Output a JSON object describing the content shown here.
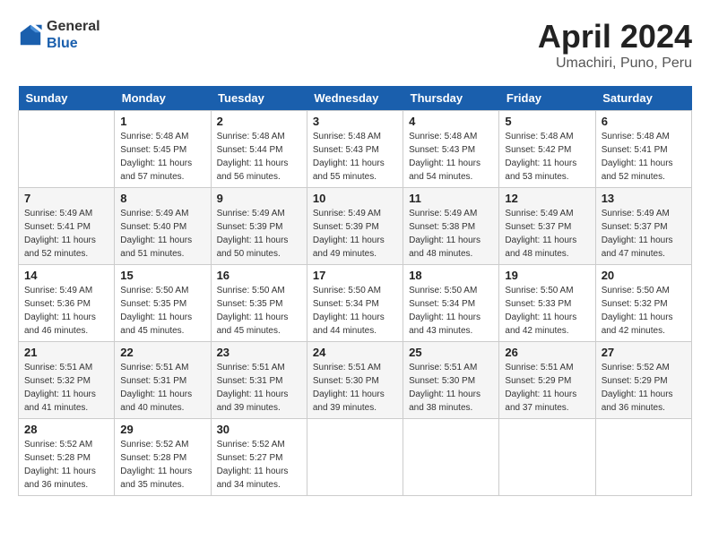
{
  "logo": {
    "general": "General",
    "blue": "Blue"
  },
  "title": "April 2024",
  "subtitle": "Umachiri, Puno, Peru",
  "days_header": [
    "Sunday",
    "Monday",
    "Tuesday",
    "Wednesday",
    "Thursday",
    "Friday",
    "Saturday"
  ],
  "weeks": [
    [
      {
        "day": "",
        "sunrise": "",
        "sunset": "",
        "daylight": ""
      },
      {
        "day": "1",
        "sunrise": "Sunrise: 5:48 AM",
        "sunset": "Sunset: 5:45 PM",
        "daylight": "Daylight: 11 hours and 57 minutes."
      },
      {
        "day": "2",
        "sunrise": "Sunrise: 5:48 AM",
        "sunset": "Sunset: 5:44 PM",
        "daylight": "Daylight: 11 hours and 56 minutes."
      },
      {
        "day": "3",
        "sunrise": "Sunrise: 5:48 AM",
        "sunset": "Sunset: 5:43 PM",
        "daylight": "Daylight: 11 hours and 55 minutes."
      },
      {
        "day": "4",
        "sunrise": "Sunrise: 5:48 AM",
        "sunset": "Sunset: 5:43 PM",
        "daylight": "Daylight: 11 hours and 54 minutes."
      },
      {
        "day": "5",
        "sunrise": "Sunrise: 5:48 AM",
        "sunset": "Sunset: 5:42 PM",
        "daylight": "Daylight: 11 hours and 53 minutes."
      },
      {
        "day": "6",
        "sunrise": "Sunrise: 5:48 AM",
        "sunset": "Sunset: 5:41 PM",
        "daylight": "Daylight: 11 hours and 52 minutes."
      }
    ],
    [
      {
        "day": "7",
        "sunrise": "Sunrise: 5:49 AM",
        "sunset": "Sunset: 5:41 PM",
        "daylight": "Daylight: 11 hours and 52 minutes."
      },
      {
        "day": "8",
        "sunrise": "Sunrise: 5:49 AM",
        "sunset": "Sunset: 5:40 PM",
        "daylight": "Daylight: 11 hours and 51 minutes."
      },
      {
        "day": "9",
        "sunrise": "Sunrise: 5:49 AM",
        "sunset": "Sunset: 5:39 PM",
        "daylight": "Daylight: 11 hours and 50 minutes."
      },
      {
        "day": "10",
        "sunrise": "Sunrise: 5:49 AM",
        "sunset": "Sunset: 5:39 PM",
        "daylight": "Daylight: 11 hours and 49 minutes."
      },
      {
        "day": "11",
        "sunrise": "Sunrise: 5:49 AM",
        "sunset": "Sunset: 5:38 PM",
        "daylight": "Daylight: 11 hours and 48 minutes."
      },
      {
        "day": "12",
        "sunrise": "Sunrise: 5:49 AM",
        "sunset": "Sunset: 5:37 PM",
        "daylight": "Daylight: 11 hours and 48 minutes."
      },
      {
        "day": "13",
        "sunrise": "Sunrise: 5:49 AM",
        "sunset": "Sunset: 5:37 PM",
        "daylight": "Daylight: 11 hours and 47 minutes."
      }
    ],
    [
      {
        "day": "14",
        "sunrise": "Sunrise: 5:49 AM",
        "sunset": "Sunset: 5:36 PM",
        "daylight": "Daylight: 11 hours and 46 minutes."
      },
      {
        "day": "15",
        "sunrise": "Sunrise: 5:50 AM",
        "sunset": "Sunset: 5:35 PM",
        "daylight": "Daylight: 11 hours and 45 minutes."
      },
      {
        "day": "16",
        "sunrise": "Sunrise: 5:50 AM",
        "sunset": "Sunset: 5:35 PM",
        "daylight": "Daylight: 11 hours and 45 minutes."
      },
      {
        "day": "17",
        "sunrise": "Sunrise: 5:50 AM",
        "sunset": "Sunset: 5:34 PM",
        "daylight": "Daylight: 11 hours and 44 minutes."
      },
      {
        "day": "18",
        "sunrise": "Sunrise: 5:50 AM",
        "sunset": "Sunset: 5:34 PM",
        "daylight": "Daylight: 11 hours and 43 minutes."
      },
      {
        "day": "19",
        "sunrise": "Sunrise: 5:50 AM",
        "sunset": "Sunset: 5:33 PM",
        "daylight": "Daylight: 11 hours and 42 minutes."
      },
      {
        "day": "20",
        "sunrise": "Sunrise: 5:50 AM",
        "sunset": "Sunset: 5:32 PM",
        "daylight": "Daylight: 11 hours and 42 minutes."
      }
    ],
    [
      {
        "day": "21",
        "sunrise": "Sunrise: 5:51 AM",
        "sunset": "Sunset: 5:32 PM",
        "daylight": "Daylight: 11 hours and 41 minutes."
      },
      {
        "day": "22",
        "sunrise": "Sunrise: 5:51 AM",
        "sunset": "Sunset: 5:31 PM",
        "daylight": "Daylight: 11 hours and 40 minutes."
      },
      {
        "day": "23",
        "sunrise": "Sunrise: 5:51 AM",
        "sunset": "Sunset: 5:31 PM",
        "daylight": "Daylight: 11 hours and 39 minutes."
      },
      {
        "day": "24",
        "sunrise": "Sunrise: 5:51 AM",
        "sunset": "Sunset: 5:30 PM",
        "daylight": "Daylight: 11 hours and 39 minutes."
      },
      {
        "day": "25",
        "sunrise": "Sunrise: 5:51 AM",
        "sunset": "Sunset: 5:30 PM",
        "daylight": "Daylight: 11 hours and 38 minutes."
      },
      {
        "day": "26",
        "sunrise": "Sunrise: 5:51 AM",
        "sunset": "Sunset: 5:29 PM",
        "daylight": "Daylight: 11 hours and 37 minutes."
      },
      {
        "day": "27",
        "sunrise": "Sunrise: 5:52 AM",
        "sunset": "Sunset: 5:29 PM",
        "daylight": "Daylight: 11 hours and 36 minutes."
      }
    ],
    [
      {
        "day": "28",
        "sunrise": "Sunrise: 5:52 AM",
        "sunset": "Sunset: 5:28 PM",
        "daylight": "Daylight: 11 hours and 36 minutes."
      },
      {
        "day": "29",
        "sunrise": "Sunrise: 5:52 AM",
        "sunset": "Sunset: 5:28 PM",
        "daylight": "Daylight: 11 hours and 35 minutes."
      },
      {
        "day": "30",
        "sunrise": "Sunrise: 5:52 AM",
        "sunset": "Sunset: 5:27 PM",
        "daylight": "Daylight: 11 hours and 34 minutes."
      },
      {
        "day": "",
        "sunrise": "",
        "sunset": "",
        "daylight": ""
      },
      {
        "day": "",
        "sunrise": "",
        "sunset": "",
        "daylight": ""
      },
      {
        "day": "",
        "sunrise": "",
        "sunset": "",
        "daylight": ""
      },
      {
        "day": "",
        "sunrise": "",
        "sunset": "",
        "daylight": ""
      }
    ]
  ]
}
